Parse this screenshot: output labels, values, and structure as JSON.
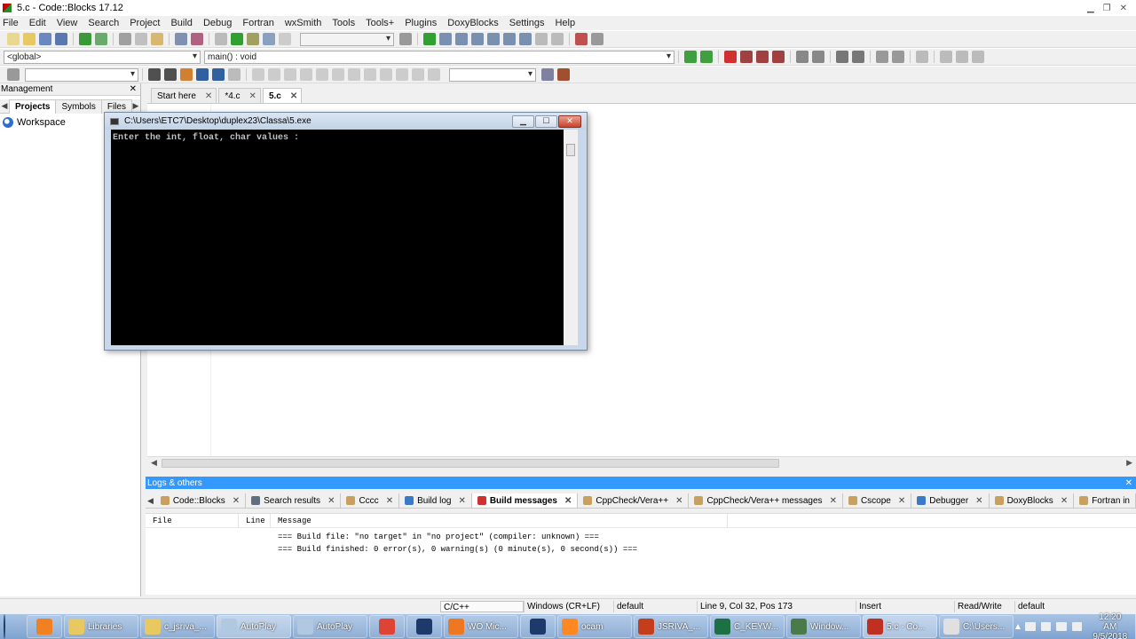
{
  "window": {
    "title": "5.c - Code::Blocks 17.12"
  },
  "menu": [
    "File",
    "Edit",
    "View",
    "Search",
    "Project",
    "Build",
    "Debug",
    "Fortran",
    "wxSmith",
    "Tools",
    "Tools+",
    "Plugins",
    "DoxyBlocks",
    "Settings",
    "Help"
  ],
  "toolbar": {
    "scope_combo": "<global>",
    "function_combo": "main() : void"
  },
  "management": {
    "title": "Management",
    "tabs": [
      "Projects",
      "Symbols",
      "Files"
    ],
    "workspace_label": "Workspace"
  },
  "editor": {
    "tabs": [
      {
        "label": "Start here",
        "active": false
      },
      {
        "label": "*4.c",
        "active": false
      },
      {
        "label": "5.c",
        "active": true
      }
    ]
  },
  "console": {
    "title": "C:\\Users\\ETC7\\Desktop\\duplex23\\Classa\\5.exe",
    "output": "Enter the int, float, char values :"
  },
  "logs": {
    "title": "Logs & others",
    "tabs": [
      {
        "label": "Code::Blocks",
        "icon_color": "#c8a060"
      },
      {
        "label": "Search results",
        "icon_color": "#607080"
      },
      {
        "label": "Cccc",
        "icon_color": "#c8a060"
      },
      {
        "label": "Build log",
        "icon_color": "#3a7ac8"
      },
      {
        "label": "Build messages",
        "icon_color": "#d03030",
        "active": true
      },
      {
        "label": "CppCheck/Vera++",
        "icon_color": "#c8a060"
      },
      {
        "label": "CppCheck/Vera++ messages",
        "icon_color": "#c8a060"
      },
      {
        "label": "Cscope",
        "icon_color": "#c8a060"
      },
      {
        "label": "Debugger",
        "icon_color": "#3a7ac8"
      },
      {
        "label": "DoxyBlocks",
        "icon_color": "#c8a060"
      },
      {
        "label": "Fortran in",
        "icon_color": "#c8a060"
      }
    ],
    "columns": [
      "File",
      "Line",
      "Message"
    ],
    "rows": [
      "=== Build file: \"no target\" in \"no project\" (compiler: unknown) ===",
      "=== Build finished: 0 error(s), 0 warning(s) (0 minute(s), 0 second(s)) ==="
    ]
  },
  "statusbar": {
    "language": "C/C++",
    "eol": "Windows (CR+LF)",
    "encoding": "default",
    "position": "Line 9, Col 32, Pos 173",
    "mode": "Insert",
    "access": "Read/Write",
    "profile": "default"
  },
  "taskbar": {
    "items": [
      {
        "label": "",
        "icon_color": "#f08020"
      },
      {
        "label": "Libraries",
        "icon_color": "#e8c860"
      },
      {
        "label": "c_jsriva_...",
        "icon_color": "#e8c860"
      },
      {
        "label": "AutoPlay",
        "icon_color": "#b0c8e0",
        "active": true
      },
      {
        "label": "AutoPlay",
        "icon_color": "#b0c8e0"
      },
      {
        "label": "",
        "icon_color": "#dd4433"
      },
      {
        "label": "",
        "icon_color": "#1e3a6a"
      },
      {
        "label": "WO Mic...",
        "icon_color": "#ee7722"
      },
      {
        "label": "",
        "icon_color": "#1e3a6a"
      },
      {
        "label": "ocam",
        "icon_color": "#ff8822"
      },
      {
        "label": "JSRIVA_...",
        "icon_color": "#c43e1c"
      },
      {
        "label": "C_KEYW...",
        "icon_color": "#1d7044"
      },
      {
        "label": "Window...",
        "icon_color": "#4a7a4a"
      },
      {
        "label": "5.c - Co...",
        "icon_color": "#c03020",
        "active": true
      },
      {
        "label": "C:\\Users...",
        "icon_color": "#e0e0e0"
      }
    ],
    "clock_time": "12:20 AM",
    "clock_date": "9/5/2018"
  }
}
